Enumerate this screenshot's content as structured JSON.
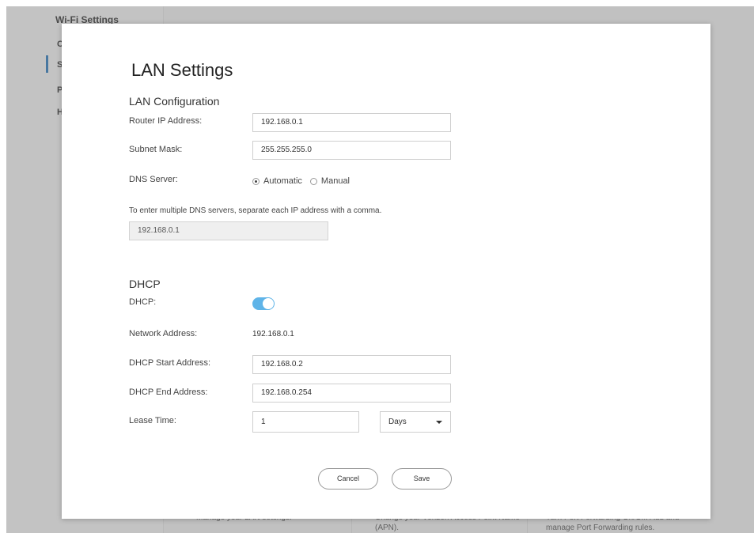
{
  "background": {
    "sidebar_title": "Wi-Fi Settings",
    "sidebar_items": [
      "C",
      "S",
      "P",
      "H"
    ],
    "cards": [
      {
        "text": "Manage your LAN settings."
      },
      {
        "text": "Change your Verizon Access Point Name (APN)."
      },
      {
        "text": "Turn Port Forwarding On/Off. Add and manage Port Forwarding rules."
      }
    ]
  },
  "modal": {
    "title": "LAN Settings",
    "lan_section": "LAN Configuration",
    "router_ip_label": "Router IP Address:",
    "router_ip_value": "192.168.0.1",
    "subnet_label": "Subnet Mask:",
    "subnet_value": "255.255.255.0",
    "dns_label": "DNS Server:",
    "dns_options": [
      "Automatic",
      "Manual"
    ],
    "dns_selected": "Automatic",
    "dns_hint": "To enter multiple DNS servers, separate each IP address with a comma.",
    "dns_value": "192.168.0.1",
    "dhcp_section": "DHCP",
    "dhcp_label": "DHCP:",
    "dhcp_enabled": true,
    "network_address_label": "Network Address:",
    "network_address_value": "192.168.0.1",
    "dhcp_start_label": "DHCP Start Address:",
    "dhcp_start_value": "192.168.0.2",
    "dhcp_end_label": "DHCP End Address:",
    "dhcp_end_value": "192.168.0.254",
    "lease_label": "Lease Time:",
    "lease_value": "1",
    "lease_unit": "Days",
    "cancel_label": "Cancel",
    "save_label": "Save"
  },
  "colors": {
    "toggle_on": "#5fb4e8",
    "accent": "#2f77b6"
  }
}
